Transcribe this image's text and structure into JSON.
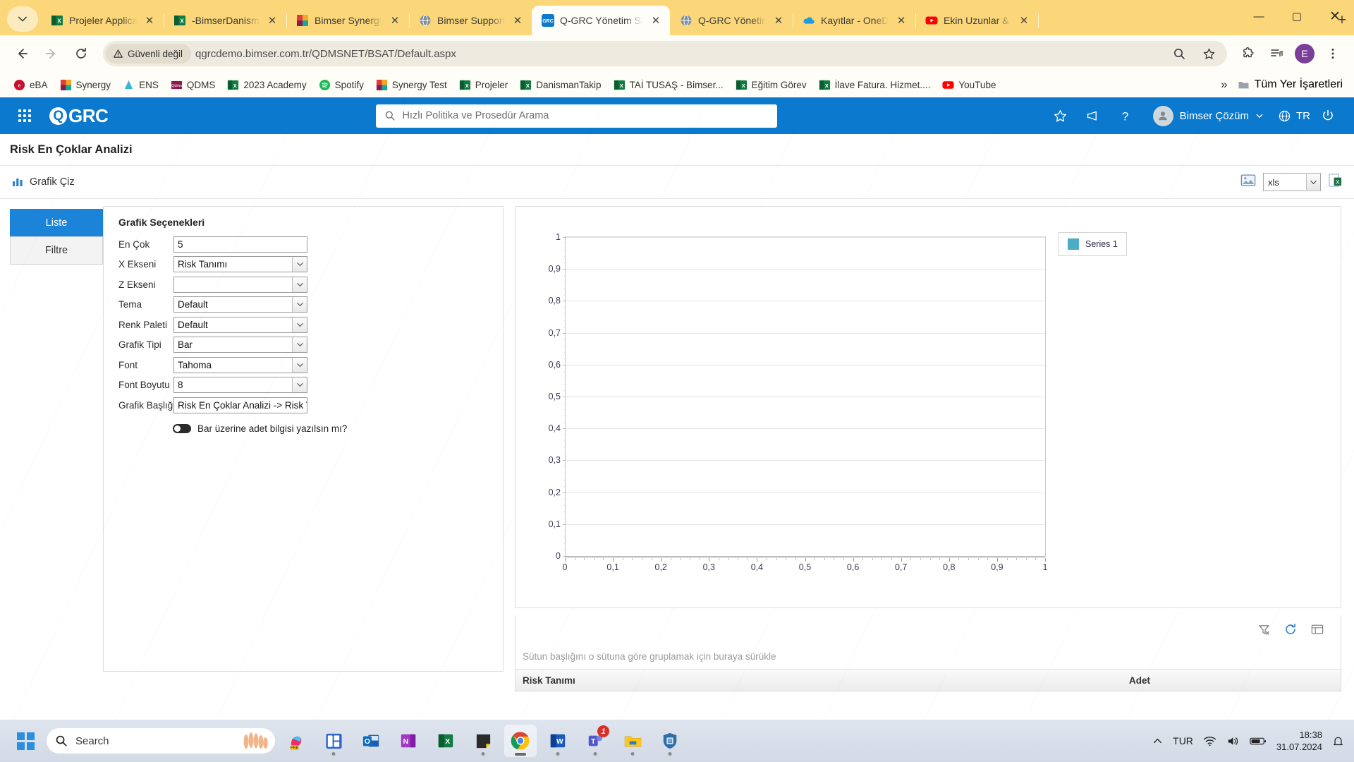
{
  "browser": {
    "tabs": [
      {
        "label": "Projeler Application",
        "icon": "excel-icon",
        "active": false
      },
      {
        "label": "-BimserDanismanTakip",
        "icon": "excel-icon",
        "active": false
      },
      {
        "label": "Bimser Synergy",
        "icon": "synergy-icon",
        "active": false
      },
      {
        "label": "Bimser Support System",
        "icon": "globe-icon",
        "active": false
      },
      {
        "label": "Q-GRC Yönetim Sistemi",
        "icon": "qgrc-icon",
        "active": true
      },
      {
        "label": "Q-GRC Yönetim Sistemi",
        "icon": "globe-icon",
        "active": false
      },
      {
        "label": "Kayıtlar - OneDrive",
        "icon": "onedrive-icon",
        "active": false
      },
      {
        "label": "Ekin Uzunlar & K...",
        "icon": "youtube-icon",
        "active": false
      }
    ],
    "new_tab_label": "+",
    "window_controls": {
      "minimize": "—",
      "maximize": "▢",
      "close": "✕"
    },
    "nav": {
      "back": "←",
      "forward": "→",
      "reload": "⟳"
    },
    "security_label": "Güvenli değil",
    "url": "qgrcdemo.bimser.com.tr/QDMSNET/BSAT/Default.aspx",
    "profile_initial": "E",
    "bookmarks": [
      {
        "label": "eBA",
        "icon": "eba-icon"
      },
      {
        "label": "Synergy",
        "icon": "synergy-icon"
      },
      {
        "label": "ENS",
        "icon": "ens-icon"
      },
      {
        "label": "QDMS",
        "icon": "qdms-icon"
      },
      {
        "label": "2023 Academy",
        "icon": "excel-icon"
      },
      {
        "label": "Spotify",
        "icon": "spotify-icon"
      },
      {
        "label": "Synergy Test",
        "icon": "synergy-icon"
      },
      {
        "label": "Projeler",
        "icon": "excel-icon"
      },
      {
        "label": "DanismanTakip",
        "icon": "excel-icon"
      },
      {
        "label": "TAİ TUSAŞ - Bimser...",
        "icon": "excel-icon"
      },
      {
        "label": "Eğitim Görev",
        "icon": "excel-icon"
      },
      {
        "label": "İlave Fatura. Hizmet....",
        "icon": "excel-icon"
      },
      {
        "label": "YouTube",
        "icon": "youtube-icon"
      }
    ],
    "bookmarks_overflow": "»",
    "all_bookmarks_label": "Tüm Yer İşaretleri"
  },
  "app": {
    "brand": "GRC",
    "brand_mark": "Q",
    "search_placeholder": "Hızlı Politika ve Prosedür Arama",
    "user_name": "Bimser Çözüm",
    "language": "TR",
    "page_title": "Risk En Çoklar Analizi",
    "action_draw_chart": "Grafik Çiz",
    "export_format": "xls"
  },
  "sidetabs": [
    {
      "label": "Liste",
      "active": true
    },
    {
      "label": "Filtre",
      "active": false
    }
  ],
  "form": {
    "title": "Grafik Seçenekleri",
    "fields": [
      {
        "label": "En Çok",
        "value": "5",
        "type": "text"
      },
      {
        "label": "X Ekseni",
        "value": "Risk Tanımı",
        "type": "select"
      },
      {
        "label": "Z Ekseni",
        "value": "",
        "type": "select"
      },
      {
        "label": "Tema",
        "value": "Default",
        "type": "select"
      },
      {
        "label": "Renk Paleti",
        "value": "Default",
        "type": "select"
      },
      {
        "label": "Grafik Tipi",
        "value": "Bar",
        "type": "select"
      },
      {
        "label": "Font",
        "value": "Tahoma",
        "type": "select"
      },
      {
        "label": "Font Boyutu",
        "value": "8",
        "type": "select"
      },
      {
        "label": "Grafik Başlığı",
        "value": "Risk En Çoklar Analizi -> Risk Tan",
        "type": "text"
      }
    ],
    "toggle_label": "Bar üzerine adet bilgisi yazılsın mı?",
    "toggle_on": false
  },
  "chart_data": {
    "type": "bar",
    "title": "",
    "xlabel": "",
    "ylabel": "",
    "categories": [],
    "values": [],
    "series": [
      {
        "name": "Series 1",
        "values": [],
        "color": "#4BACC6"
      }
    ],
    "legend": [
      "Series 1"
    ],
    "legend_position": "right",
    "grid": true,
    "xlim": [
      0,
      1
    ],
    "ylim": [
      0,
      1
    ],
    "xticks": [
      "0",
      "0,1",
      "0,2",
      "0,3",
      "0,4",
      "0,5",
      "0,6",
      "0,7",
      "0,8",
      "0,9",
      "1"
    ],
    "yticks": [
      "0",
      "0,1",
      "0,2",
      "0,3",
      "0,4",
      "0,5",
      "0,6",
      "0,7",
      "0,8",
      "0,9",
      "1"
    ]
  },
  "grid": {
    "group_hint": "Sütun başlığını o sütuna göre gruplamak için buraya sürükle",
    "columns": [
      "Risk Tanımı",
      "Adet"
    ],
    "rows": []
  },
  "taskbar": {
    "search_placeholder": "Search",
    "apps": [
      "copilot-icon",
      "widgets-icon",
      "outlook-icon",
      "onenote-icon",
      "excel-icon",
      "sticky-notes-icon",
      "chrome-icon",
      "word-icon",
      "teams-icon",
      "file-explorer-icon",
      "security-icon"
    ],
    "teams_badge": "1",
    "language": "TUR",
    "time": "18:38",
    "date": "31.07.2024"
  },
  "colors": {
    "accent": "#0B79CD",
    "series_1": "#4BACC6",
    "tab_strip": "#FBD77A",
    "active_tab_side": "#1b84D8"
  }
}
